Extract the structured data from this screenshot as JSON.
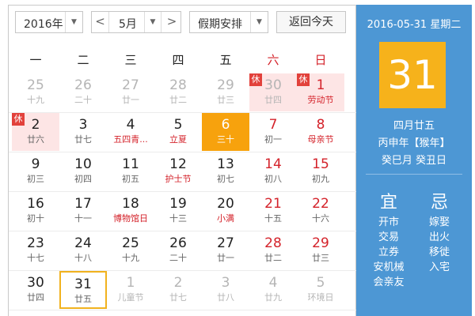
{
  "toolbar": {
    "year": "2016年",
    "prev": "<",
    "month": "5月",
    "next": ">",
    "holiday": "假期安排",
    "today_btn": "返回今天",
    "dropdown_arrow": "▼"
  },
  "weekdays": [
    "一",
    "二",
    "三",
    "四",
    "五",
    "六",
    "日"
  ],
  "badge": "休",
  "weeks": [
    [
      {
        "d": "25",
        "l": "十九",
        "other": true
      },
      {
        "d": "26",
        "l": "二十",
        "other": true
      },
      {
        "d": "27",
        "l": "廿一",
        "other": true
      },
      {
        "d": "28",
        "l": "廿二",
        "other": true
      },
      {
        "d": "29",
        "l": "廿三",
        "other": true
      },
      {
        "d": "30",
        "l": "廿四",
        "other": true,
        "holiday": true,
        "badge": true
      },
      {
        "d": "1",
        "l": "劳动节",
        "holiday": true,
        "badge": true,
        "fest": true
      }
    ],
    [
      {
        "d": "2",
        "l": "廿六",
        "holiday": true,
        "badge": true
      },
      {
        "d": "3",
        "l": "廿七"
      },
      {
        "d": "4",
        "l": "五四青...",
        "fest": true
      },
      {
        "d": "5",
        "l": "立夏",
        "fest": true
      },
      {
        "d": "6",
        "l": "三十",
        "today": true
      },
      {
        "d": "7",
        "l": "初一"
      },
      {
        "d": "8",
        "l": "母亲节",
        "fest": true
      }
    ],
    [
      {
        "d": "9",
        "l": "初三"
      },
      {
        "d": "10",
        "l": "初四"
      },
      {
        "d": "11",
        "l": "初五"
      },
      {
        "d": "12",
        "l": "护士节",
        "fest": true
      },
      {
        "d": "13",
        "l": "初七"
      },
      {
        "d": "14",
        "l": "初八"
      },
      {
        "d": "15",
        "l": "初九"
      }
    ],
    [
      {
        "d": "16",
        "l": "初十"
      },
      {
        "d": "17",
        "l": "十一"
      },
      {
        "d": "18",
        "l": "博物馆日",
        "fest": true
      },
      {
        "d": "19",
        "l": "十三"
      },
      {
        "d": "20",
        "l": "小满",
        "fest": true
      },
      {
        "d": "21",
        "l": "十五"
      },
      {
        "d": "22",
        "l": "十六"
      }
    ],
    [
      {
        "d": "23",
        "l": "十七"
      },
      {
        "d": "24",
        "l": "十八"
      },
      {
        "d": "25",
        "l": "十九"
      },
      {
        "d": "26",
        "l": "二十"
      },
      {
        "d": "27",
        "l": "廿一"
      },
      {
        "d": "28",
        "l": "廿二"
      },
      {
        "d": "29",
        "l": "廿三"
      }
    ],
    [
      {
        "d": "30",
        "l": "廿四"
      },
      {
        "d": "31",
        "l": "廿五",
        "selected": true
      },
      {
        "d": "1",
        "l": "儿童节",
        "other": true
      },
      {
        "d": "2",
        "l": "廿七",
        "other": true
      },
      {
        "d": "3",
        "l": "廿八",
        "other": true
      },
      {
        "d": "4",
        "l": "廿九",
        "other": true
      },
      {
        "d": "5",
        "l": "环境日",
        "other": true
      }
    ]
  ],
  "side": {
    "date": "2016-05-31 星期二",
    "big_day": "31",
    "lunar": "四月廿五",
    "year_gz": "丙申年【猴年】",
    "month_gz": "癸巳月 癸丑日",
    "yi_label": "宜",
    "ji_label": "忌",
    "yi": [
      "开市",
      "交易",
      "立券",
      "安机械",
      "会亲友"
    ],
    "ji": [
      "嫁娶",
      "出火",
      "移徙",
      "入宅"
    ]
  },
  "colors": {
    "side_bg": "#4d97d4",
    "today_bg": "#f7a20d",
    "big_bg": "#f6b21b",
    "red": "#d4222a",
    "holiday_bg": "#fde5e5"
  }
}
